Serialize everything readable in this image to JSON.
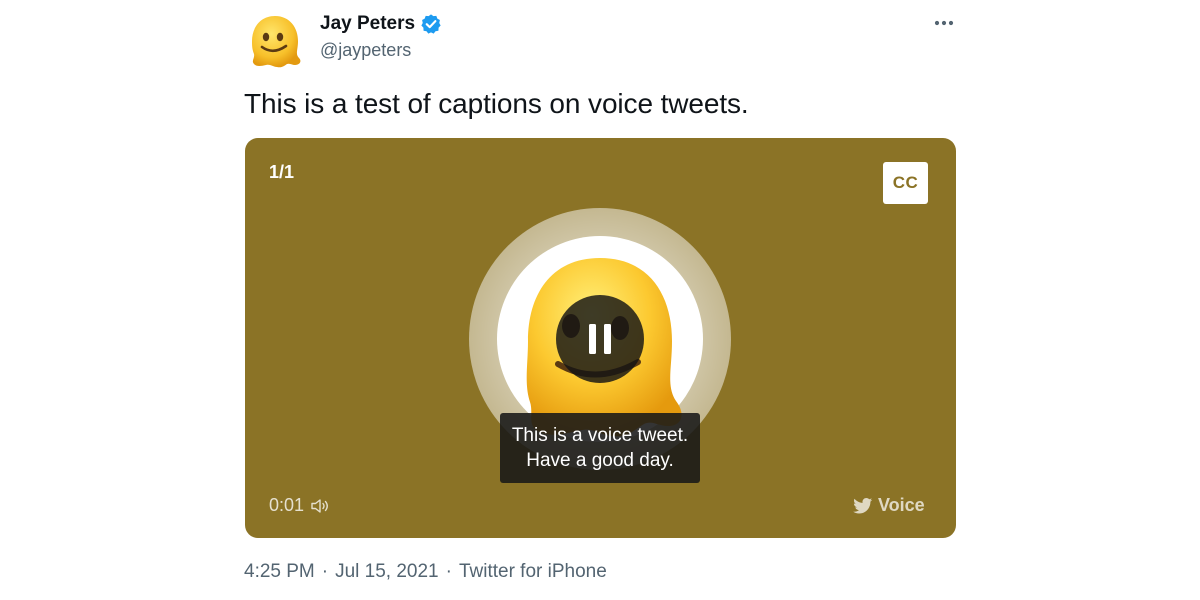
{
  "author": {
    "name": "Jay Peters",
    "handle": "@jaypeters",
    "verified": true,
    "avatar_icon": "melting-face-emoji"
  },
  "more_icon": "more-horizontal-icon",
  "tweet": {
    "text": "This is a test of captions on voice tweets."
  },
  "voice_card": {
    "background_color": "#8b7326",
    "counter": "1/1",
    "cc_label": "CC",
    "caption_line_1": "This is a voice tweet.",
    "caption_line_2": "Have a good day.",
    "elapsed": "0:01",
    "badge_label": "Voice",
    "state": "playing"
  },
  "meta": {
    "time": "4:25 PM",
    "separator": "·",
    "date": "Jul 15, 2021",
    "source": "Twitter for iPhone"
  }
}
